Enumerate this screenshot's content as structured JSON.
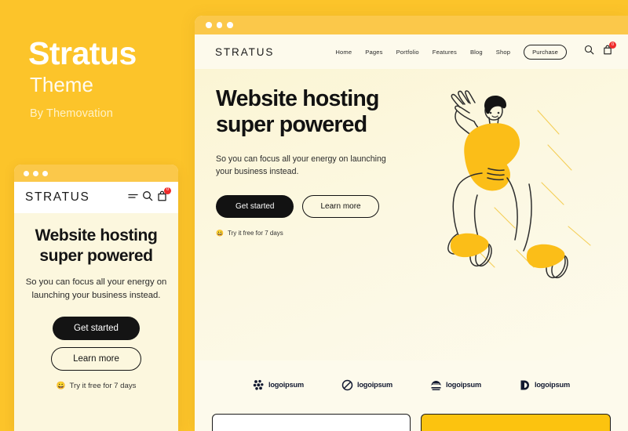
{
  "page": {
    "background_color": "#FCC42A",
    "promo": {
      "title": "Stratus",
      "subtitle": "Theme",
      "byline": "By Themovation"
    }
  },
  "mobile_mockup": {
    "titlebar_dots": 3,
    "logo": "STRATUS",
    "icons": [
      "hamburger-icon",
      "search-icon",
      "cart-icon"
    ],
    "cart_badge": "0",
    "heading": "Website hosting super powered",
    "paragraph": "So you can focus all your energy on launching your business instead.",
    "primary_button": "Get started",
    "secondary_button": "Learn more",
    "trial_note": "Try it free for 7 days",
    "trial_emoji": "😀"
  },
  "desktop_mockup": {
    "titlebar_dots": 3,
    "logo": "STRATUS",
    "nav_items": [
      {
        "label": "Home"
      },
      {
        "label": "Pages"
      },
      {
        "label": "Portfolio"
      },
      {
        "label": "Features"
      },
      {
        "label": "Blog"
      },
      {
        "label": "Shop"
      }
    ],
    "purchase_button": "Purchase",
    "cart_badge": "0",
    "hero": {
      "heading_line1": "Website hosting",
      "heading_line2": "super powered",
      "paragraph": "So you can focus all your energy on launching your business instead.",
      "primary_button": "Get started",
      "secondary_button": "Learn more",
      "trial_note": "Try it free for 7 days",
      "trial_emoji": "😀"
    },
    "logo_strip": [
      {
        "name": "logoipsum",
        "icon": "dots-cluster-icon"
      },
      {
        "name": "logoipsum",
        "icon": "circle-slash-icon"
      },
      {
        "name": "logoipsum",
        "icon": "waves-dome-icon"
      },
      {
        "name": "logoipsum",
        "icon": "half-moon-icon"
      }
    ],
    "cards": [
      {
        "style": "white-outlined"
      },
      {
        "style": "yellow-outlined"
      }
    ]
  },
  "colors": {
    "brand_yellow": "#FCC42A",
    "titlebar_yellow": "#FBC84A",
    "cream": "#FDFAEC",
    "hero_cream": "#FBF5D4",
    "ink": "#121212",
    "badge_red": "#EF2B2B",
    "logo_navy": "#121930",
    "card_yellow": "#FCC30F"
  }
}
